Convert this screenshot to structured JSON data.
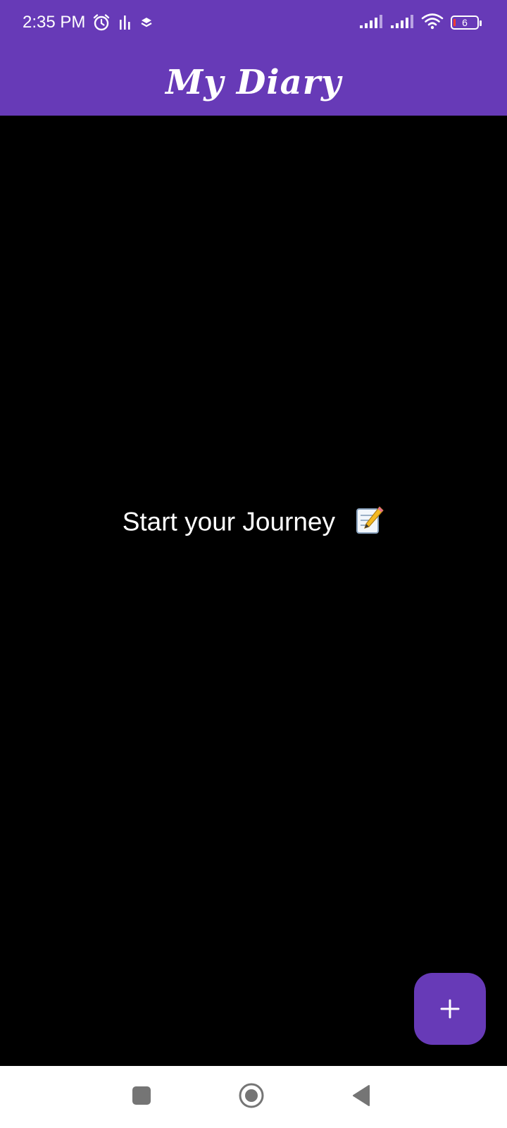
{
  "status_bar": {
    "time": "2:35 PM",
    "battery_level": "6",
    "icons": [
      "alarm-icon",
      "equalizer-icon",
      "layers-icon",
      "signal-icon",
      "signal-icon",
      "wifi-icon",
      "battery-icon"
    ]
  },
  "app_bar": {
    "title": "My Diary"
  },
  "content": {
    "empty_message": "Start your Journey",
    "empty_emoji": "📝"
  },
  "fab": {
    "icon": "plus-icon",
    "label": "+"
  },
  "nav_bar": {
    "buttons": [
      "recents-button",
      "home-button",
      "back-button"
    ]
  },
  "colors": {
    "primary": "#673AB7",
    "background": "#000000",
    "text": "#FFFFFF",
    "nav_background": "#FFFFFF",
    "nav_icon": "#757575"
  }
}
